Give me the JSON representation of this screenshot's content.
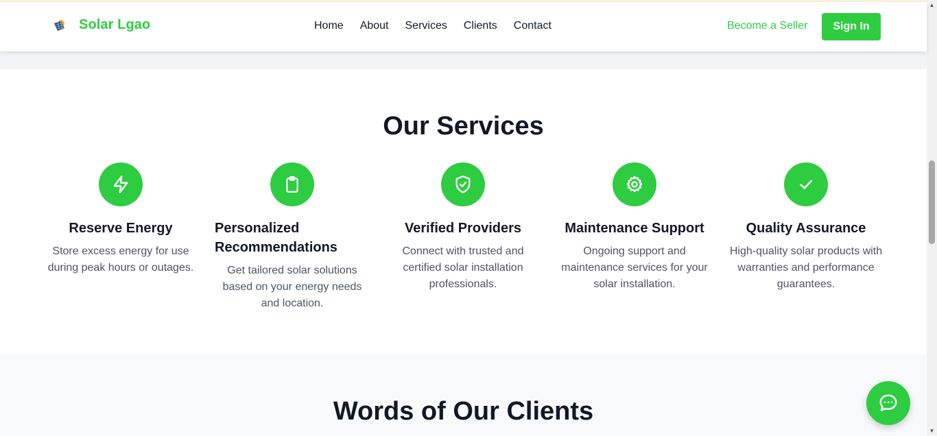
{
  "header": {
    "brand": "Solar Lgao",
    "nav": [
      "Home",
      "About",
      "Services",
      "Clients",
      "Contact"
    ],
    "seller_link": "Become a Seller",
    "signin_label": "Sign In"
  },
  "services": {
    "title": "Our Services",
    "items": [
      {
        "icon": "lightning-icon",
        "title": "Reserve Energy",
        "desc": "Store excess energy for use during peak hours or outages."
      },
      {
        "icon": "clipboard-icon",
        "title": "Personalized Recommendations",
        "desc": "Get tailored solar solutions based on your energy needs and location."
      },
      {
        "icon": "shield-check-icon",
        "title": "Verified Providers",
        "desc": "Connect with trusted and certified solar installation professionals."
      },
      {
        "icon": "gear-icon",
        "title": "Maintenance Support",
        "desc": "Ongoing support and maintenance services for your solar installation."
      },
      {
        "icon": "checkmark-icon",
        "title": "Quality Assurance",
        "desc": "High-quality solar products with warranties and performance guarantees."
      }
    ]
  },
  "clients": {
    "title": "Words of Our Clients"
  },
  "chat": {
    "icon": "chat-icon"
  },
  "colors": {
    "accent": "#2ecc40",
    "text": "#111827",
    "muted": "#4b5563",
    "section_bg": "#f8f9fa"
  }
}
